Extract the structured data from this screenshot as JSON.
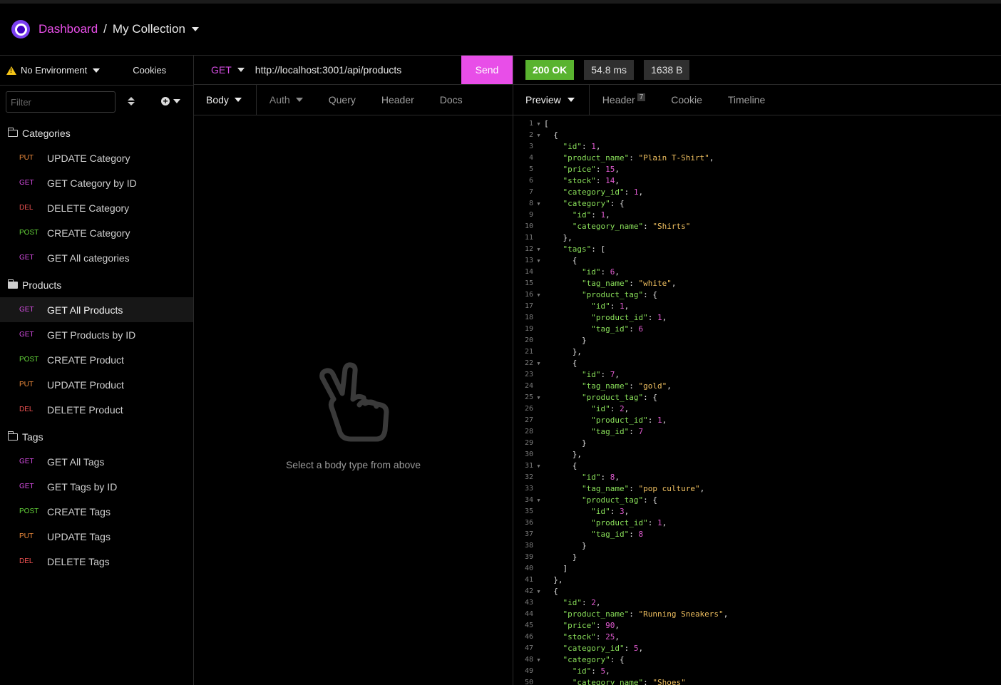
{
  "header": {
    "breadcrumb_root": "Dashboard",
    "breadcrumb_sep": "/",
    "collection": "My Collection"
  },
  "sidebar": {
    "environment": "No Environment",
    "cookies": "Cookies",
    "filter_placeholder": "Filter",
    "groups": [
      {
        "label": "Categories",
        "items": [
          {
            "method": "PUT",
            "label": "UPDATE Category"
          },
          {
            "method": "GET",
            "label": "GET Category by ID"
          },
          {
            "method": "DEL",
            "label": "DELETE Category"
          },
          {
            "method": "POST",
            "label": "CREATE Category"
          },
          {
            "method": "GET",
            "label": "GET All categories"
          }
        ]
      },
      {
        "label": "Products",
        "items": [
          {
            "method": "GET",
            "label": "GET All Products"
          },
          {
            "method": "GET",
            "label": "GET Products by ID"
          },
          {
            "method": "POST",
            "label": "CREATE Product"
          },
          {
            "method": "PUT",
            "label": "UPDATE Product"
          },
          {
            "method": "DEL",
            "label": "DELETE Product"
          }
        ]
      },
      {
        "label": "Tags",
        "items": [
          {
            "method": "GET",
            "label": "GET All Tags"
          },
          {
            "method": "GET",
            "label": "GET Tags by ID"
          },
          {
            "method": "POST",
            "label": "CREATE Tags"
          },
          {
            "method": "PUT",
            "label": "UPDATE Tags"
          },
          {
            "method": "DEL",
            "label": "DELETE Tags"
          }
        ]
      }
    ]
  },
  "request": {
    "method": "GET",
    "url": "http://localhost:3001/api/products",
    "send_label": "Send",
    "tabs": [
      "Body",
      "Auth",
      "Query",
      "Header",
      "Docs"
    ],
    "empty_message": "Select a body type from above"
  },
  "response": {
    "status": "200 OK",
    "time": "54.8 ms",
    "size": "1638 B",
    "tabs": [
      "Preview",
      "Header",
      "Cookie",
      "Timeline"
    ],
    "header_count": "7",
    "lines": [
      "[",
      "  {",
      "    \"id\": 1,",
      "    \"product_name\": \"Plain T-Shirt\",",
      "    \"price\": 15,",
      "    \"stock\": 14,",
      "    \"category_id\": 1,",
      "    \"category\": {",
      "      \"id\": 1,",
      "      \"category_name\": \"Shirts\"",
      "    },",
      "    \"tags\": [",
      "      {",
      "        \"id\": 6,",
      "        \"tag_name\": \"white\",",
      "        \"product_tag\": {",
      "          \"id\": 1,",
      "          \"product_id\": 1,",
      "          \"tag_id\": 6",
      "        }",
      "      },",
      "      {",
      "        \"id\": 7,",
      "        \"tag_name\": \"gold\",",
      "        \"product_tag\": {",
      "          \"id\": 2,",
      "          \"product_id\": 1,",
      "          \"tag_id\": 7",
      "        }",
      "      },",
      "      {",
      "        \"id\": 8,",
      "        \"tag_name\": \"pop culture\",",
      "        \"product_tag\": {",
      "          \"id\": 3,",
      "          \"product_id\": 1,",
      "          \"tag_id\": 8",
      "        }",
      "      }",
      "    ]",
      "  },",
      "  {",
      "    \"id\": 2,",
      "    \"product_name\": \"Running Sneakers\",",
      "    \"price\": 90,",
      "    \"stock\": 25,",
      "    \"category_id\": 5,",
      "    \"category\": {",
      "      \"id\": 5,",
      "      \"category_name\": \"Shoes\""
    ],
    "foldable_lines": [
      1,
      2,
      8,
      12,
      13,
      16,
      22,
      25,
      31,
      34,
      42,
      48
    ]
  },
  "colors": {
    "accent": "#e84ee8",
    "ok": "#59b32f",
    "get": "#d64ce3",
    "put": "#f08c3c",
    "del": "#ef5252",
    "post": "#66d83b"
  },
  "icons": [
    "logo-icon",
    "warning-icon",
    "sort-icon",
    "add-icon",
    "folder-icon",
    "folder-open-icon",
    "peace-hand-icon",
    "chevron-down-icon"
  ]
}
